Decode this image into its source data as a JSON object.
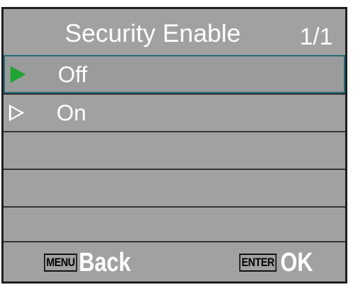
{
  "header": {
    "title": "Security Enable",
    "page_indicator": "1/1"
  },
  "menu": {
    "items": [
      {
        "label": "Off",
        "selected": true,
        "marker_icon": "play-triangle-filled-icon",
        "marker_color": "#1ea532"
      },
      {
        "label": "On",
        "selected": false,
        "marker_icon": "play-triangle-outline-icon",
        "marker_color": "#ffffff"
      }
    ],
    "empty_rows": 3
  },
  "footer": {
    "back_key": "MENU",
    "back_label": "Back",
    "ok_key": "ENTER",
    "ok_label": "OK"
  },
  "colors": {
    "screen_background": "#a1a1a1",
    "text": "#ffffff",
    "selection_border": "#1f6a78",
    "divider": "#333333"
  }
}
